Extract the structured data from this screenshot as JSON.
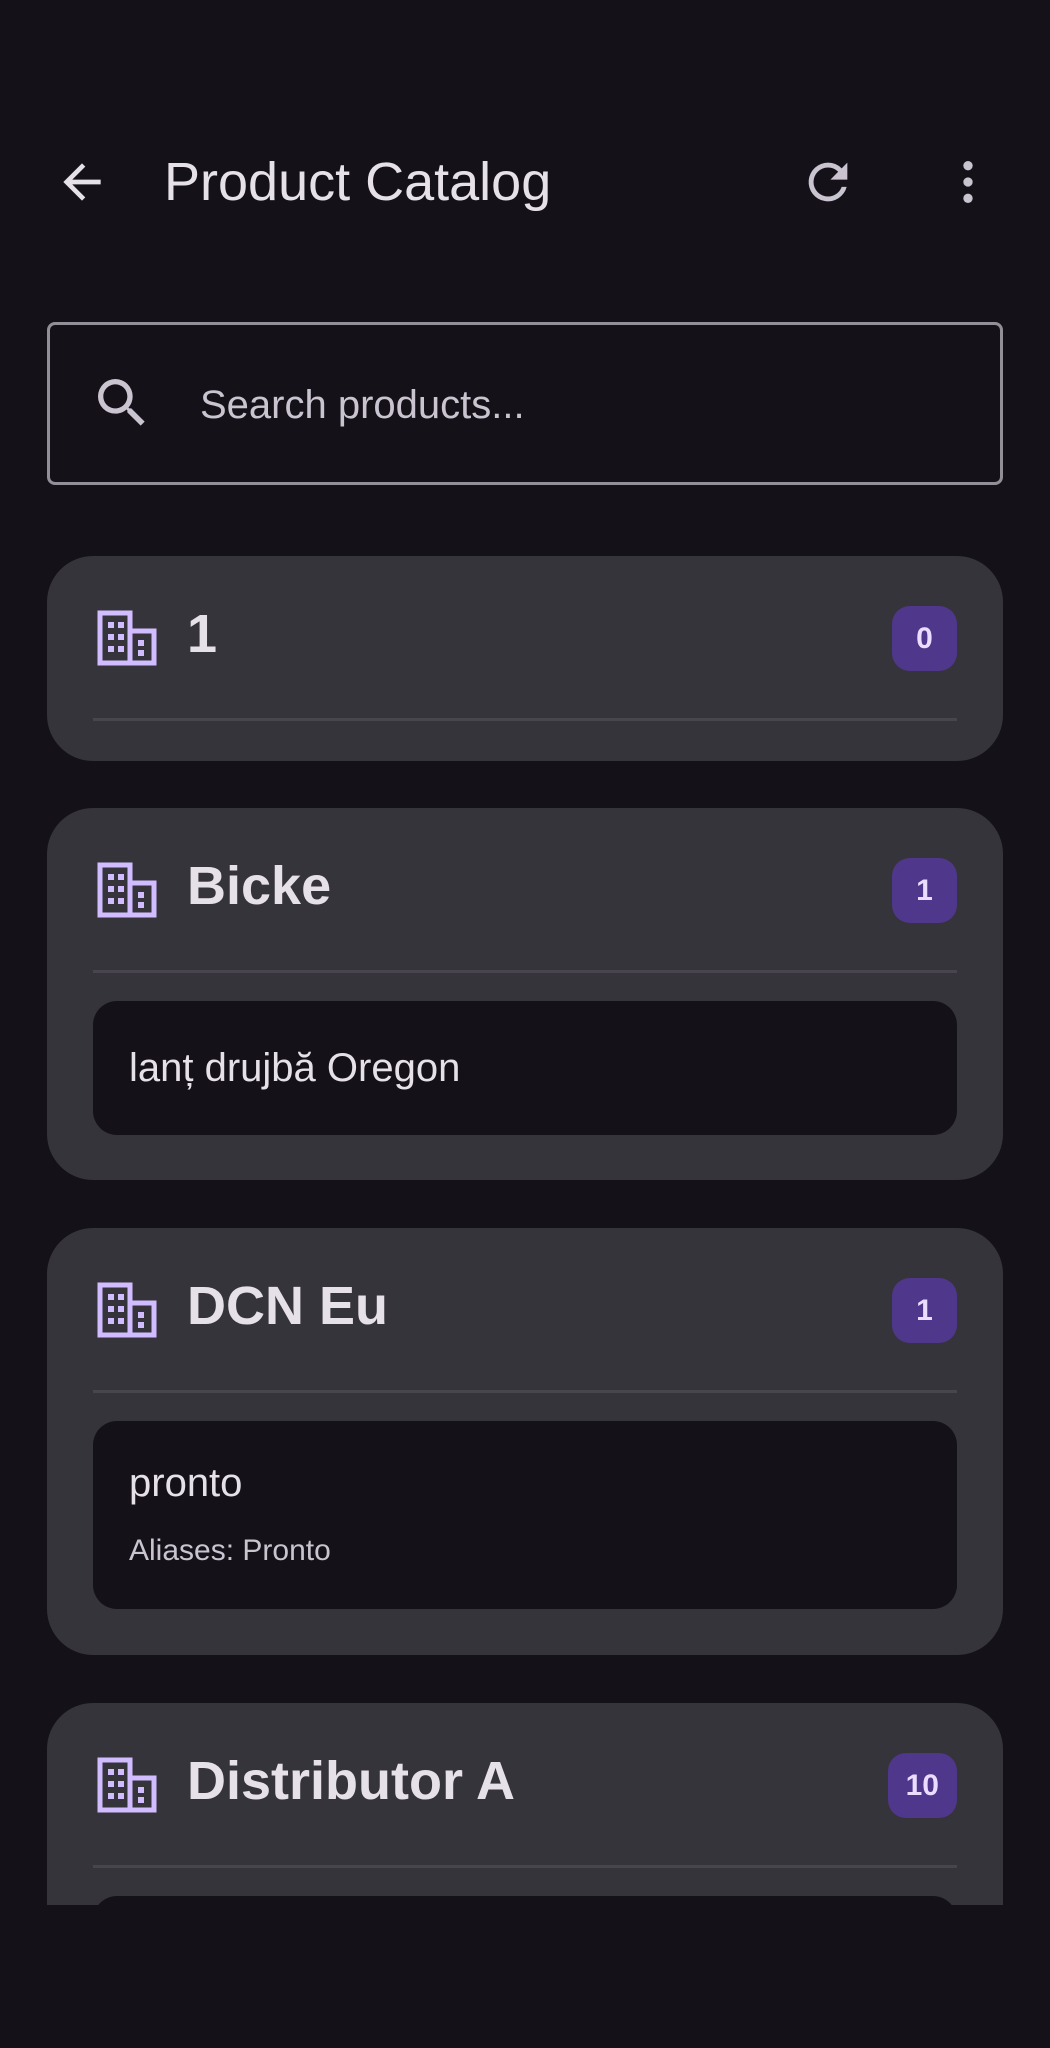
{
  "appbar": {
    "title": "Product Catalog",
    "back_icon": "arrow-back-icon",
    "refresh_icon": "refresh-icon",
    "more_icon": "more-vert-icon"
  },
  "search": {
    "placeholder": "Search products...",
    "value": "",
    "icon": "search-icon"
  },
  "colors": {
    "background": "#141218",
    "card": "#36343B",
    "accent": "#D0BCFF",
    "badge": "#4F378B",
    "outline": "#938F99"
  },
  "suppliers": [
    {
      "name": "1",
      "count": "0",
      "icon": "building-icon",
      "products": []
    },
    {
      "name": "Bicke",
      "count": "1",
      "icon": "building-icon",
      "products": [
        {
          "name": "lanț drujbă Oregon"
        }
      ]
    },
    {
      "name": "DCN Eu",
      "count": "1",
      "icon": "building-icon",
      "products": [
        {
          "name": "pronto",
          "aliases": "Aliases: Pronto"
        }
      ]
    },
    {
      "name": "Distributor A",
      "count": "10",
      "icon": "building-icon",
      "products": []
    }
  ]
}
